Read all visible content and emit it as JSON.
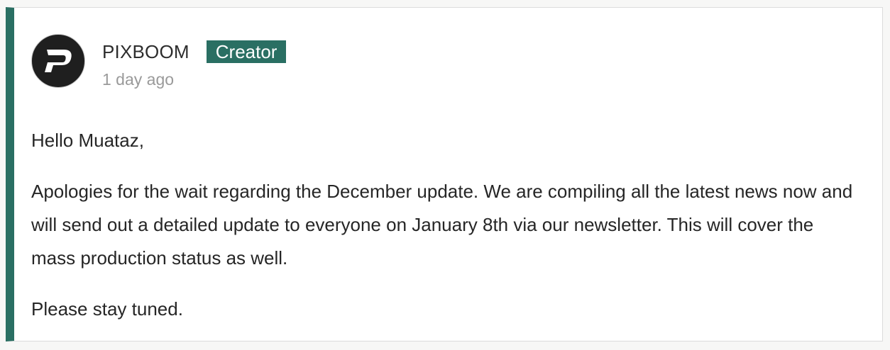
{
  "comment": {
    "author": "PIXBOOM",
    "badge": "Creator",
    "timestamp": "1 day ago",
    "avatar_icon": "pixboom-logo-icon",
    "accent_color": "#2a6f63",
    "paragraphs": [
      "Hello Muataz,",
      "Apologies for the wait regarding the December update. We are compiling all the latest news now and will send out a detailed update to everyone on January 8th via our newsletter. This will cover the mass production status as well.",
      "Please stay tuned."
    ]
  }
}
